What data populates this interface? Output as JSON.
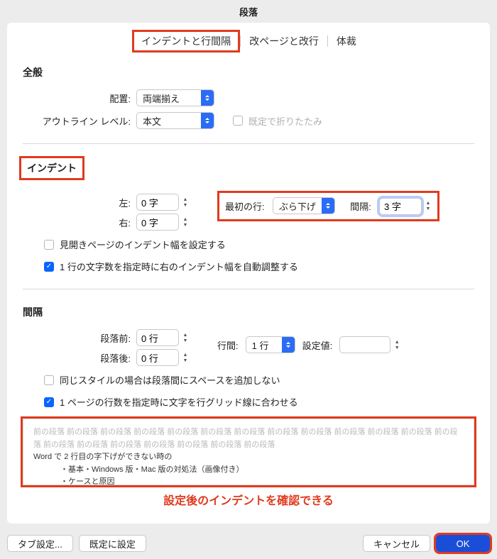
{
  "title": "段落",
  "tabs": {
    "t0": "インデントと行間隔",
    "t1": "改ページと改行",
    "t2": "体裁"
  },
  "general": {
    "title": "全般",
    "align_label": "配置:",
    "align_value": "両端揃え",
    "outline_label": "アウトライン レベル:",
    "outline_value": "本文",
    "collapse_label": "既定で折りたたみ"
  },
  "indent": {
    "title": "インデント",
    "left_label": "左:",
    "left_value": "0 字",
    "right_label": "右:",
    "right_value": "0 字",
    "first_label": "最初の行:",
    "first_value": "ぶら下げ",
    "gap_label": "間隔:",
    "gap_value": "3 字",
    "mirror": "見開きページのインデント幅を設定する",
    "auto": "1 行の文字数を指定時に右のインデント幅を自動調整する"
  },
  "spacing": {
    "title": "間隔",
    "before_label": "段落前:",
    "before_value": "0 行",
    "after_label": "段落後:",
    "after_value": "0 行",
    "line_label": "行間:",
    "line_value": "1 行",
    "set_label": "設定値:",
    "set_value": "",
    "nosame": "同じスタイルの場合は段落間にスペースを追加しない",
    "snap": "1 ページの行数を指定時に文字を行グリッド線に合わせる"
  },
  "preview": {
    "ghost": "前の段落 前の段落 前の段落 前の段落 前の段落 前の段落 前の段落 前の段落 前の段落 前の段落 前の段落 前の段落 前の段落 前の段落 前の段落 前の段落 前の段落 前の段落 前の段落 前の段落",
    "line1": "Word で 2 行目の字下げができない時の",
    "line2": "・基本・Windows 版・Mac 版の対処法（画像付き）",
    "line3": "・ケースと原因"
  },
  "annotate": "設定後のインデントを確認できる",
  "footer": {
    "tabs_btn": "タブ設定...",
    "default_btn": "既定に設定",
    "cancel": "キャンセル",
    "ok": "OK"
  }
}
